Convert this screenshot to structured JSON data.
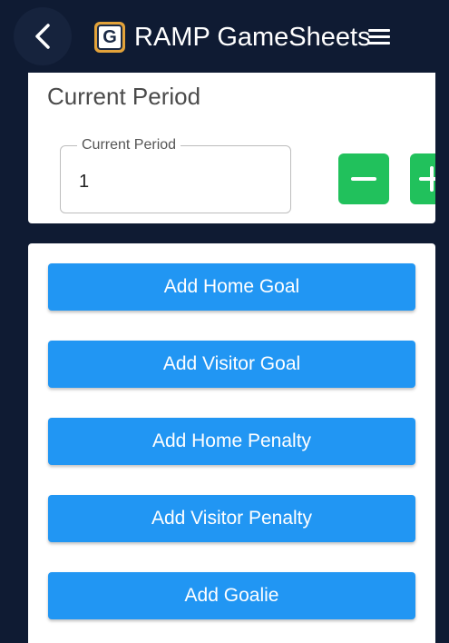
{
  "header": {
    "title": "RAMP GameSheets",
    "logo_letter": "G",
    "back_icon": "chevron-left-icon",
    "menu_icon": "hamburger-menu-icon"
  },
  "period": {
    "heading": "Current Period",
    "field_label": "Current Period",
    "value": "1",
    "decrement_icon": "minus-icon",
    "increment_icon": "plus-icon"
  },
  "actions": [
    {
      "label": "Add Home Goal"
    },
    {
      "label": "Add Visitor Goal"
    },
    {
      "label": "Add Home Penalty"
    },
    {
      "label": "Add Visitor Penalty"
    },
    {
      "label": "Add Goalie"
    }
  ],
  "colors": {
    "background": "#0f1b33",
    "primary": "#2196f3",
    "success": "#21c15c",
    "logo_accent": "#e3a33a"
  }
}
